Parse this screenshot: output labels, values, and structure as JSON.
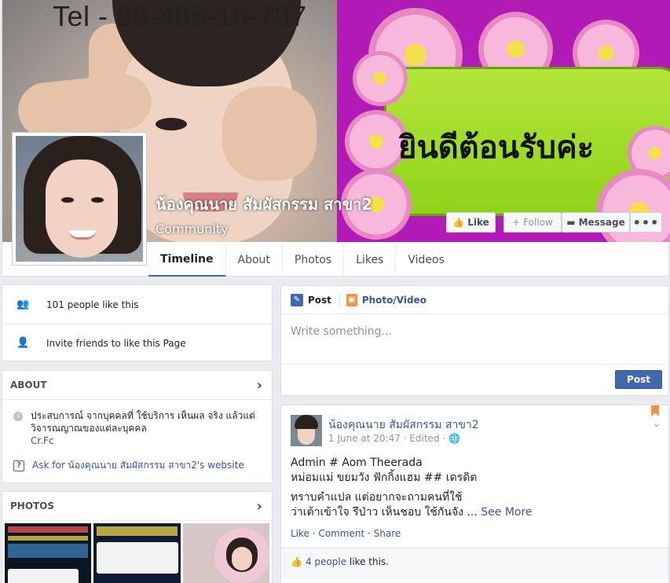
{
  "cover": {
    "phone_text": "Tel - 08-485-16-737",
    "welcome_text": "ยินดีต้อนรับค่ะ"
  },
  "header": {
    "page_name": "น้องคุณนาย สัมผัสกรรม สาขา2",
    "category": "Community",
    "buttons": {
      "like": "Like",
      "follow": "Follow",
      "message": "Message",
      "more": "•••"
    }
  },
  "tabs": [
    {
      "label": "Timeline",
      "active": true
    },
    {
      "label": "About",
      "active": false
    },
    {
      "label": "Photos",
      "active": false
    },
    {
      "label": "Likes",
      "active": false
    },
    {
      "label": "Videos",
      "active": false
    }
  ],
  "sidebar": {
    "likes_text": "101 people like this",
    "invite_text": "Invite friends to like this Page",
    "about": {
      "heading": "ABOUT",
      "description": "ประสบการณ์ จากบุคคลที่ ใช้บริการ เห็นผล จริง แล้วแต่วิจารณญาณของแต่ละบุคคล",
      "credit": "Cr.Fc",
      "website_link": "Ask for น้องคุณนาย สัมผัสกรรม สาขา2's website"
    },
    "photos": {
      "heading": "PHOTOS"
    }
  },
  "composer": {
    "post_tab": "Post",
    "photo_tab": "Photo/Video",
    "placeholder": "Write something...",
    "post_button": "Post"
  },
  "story": {
    "author": "น้องคุณนาย สัมผัสกรรม สาขา2",
    "meta": "1 June at 20:47 · Edited · ",
    "line1": "Admin # Aom Theerada",
    "line2": "หม่อมแม่ ขยมวัง ฟักกิ้งแฮม ## เดรดิต",
    "line3": "ทราบคำแปล แต่อยากจะถามคนที่ใช้",
    "line4": "ว่าเต้าเข้าใจ รึป่าว เห็นชอบ ใช้กันจัง ... ",
    "see_more": "See More",
    "actions": {
      "like": "Like",
      "comment": "Comment",
      "share": "Share"
    },
    "likes_count": "4 people",
    "likes_suffix": " like this."
  },
  "colors": {
    "brand": "#4267b2",
    "link": "#365899",
    "background": "#e9ebee"
  }
}
